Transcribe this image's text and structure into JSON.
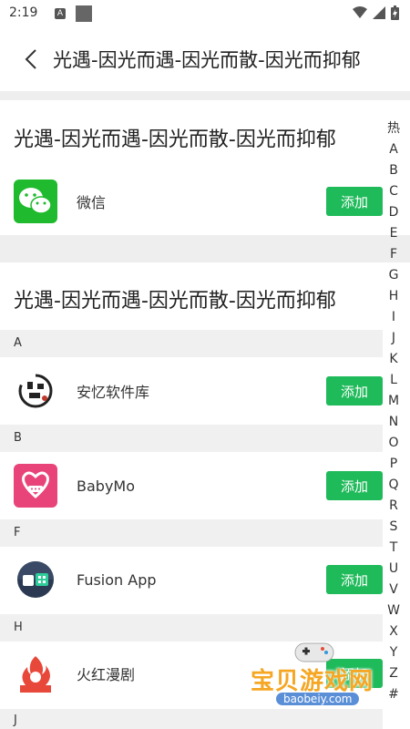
{
  "status": {
    "time": "2:19",
    "a_badge": "A"
  },
  "header": {
    "title": "光遇-因光而遇-因光而散-因光而抑郁"
  },
  "section_hot": {
    "title": "光遇-因光而遇-因光而散-因光而抑郁",
    "items": [
      {
        "name": "微信",
        "button": "添加"
      }
    ]
  },
  "section_all": {
    "title": "光遇-因光而遇-因光而散-因光而抑郁",
    "groups": [
      {
        "letter": "A",
        "name": "安忆软件库",
        "button": "添加"
      },
      {
        "letter": "B",
        "name": "BabyMo",
        "button": "添加"
      },
      {
        "letter": "F",
        "name": "Fusion App",
        "button": "添加"
      },
      {
        "letter": "H",
        "name": "火红漫剧",
        "button": "添加"
      }
    ],
    "trailing_letter": "J"
  },
  "index_bar": [
    "热",
    "A",
    "B",
    "C",
    "D",
    "E",
    "F",
    "G",
    "H",
    "I",
    "J",
    "K",
    "L",
    "M",
    "N",
    "O",
    "P",
    "Q",
    "R",
    "S",
    "T",
    "U",
    "V",
    "W",
    "X",
    "Y",
    "Z",
    "#"
  ],
  "watermark": {
    "text": "宝贝游戏网",
    "url": "baobeiy.com"
  },
  "colors": {
    "accent": "#1fba5a",
    "gap": "#eeeeee"
  }
}
